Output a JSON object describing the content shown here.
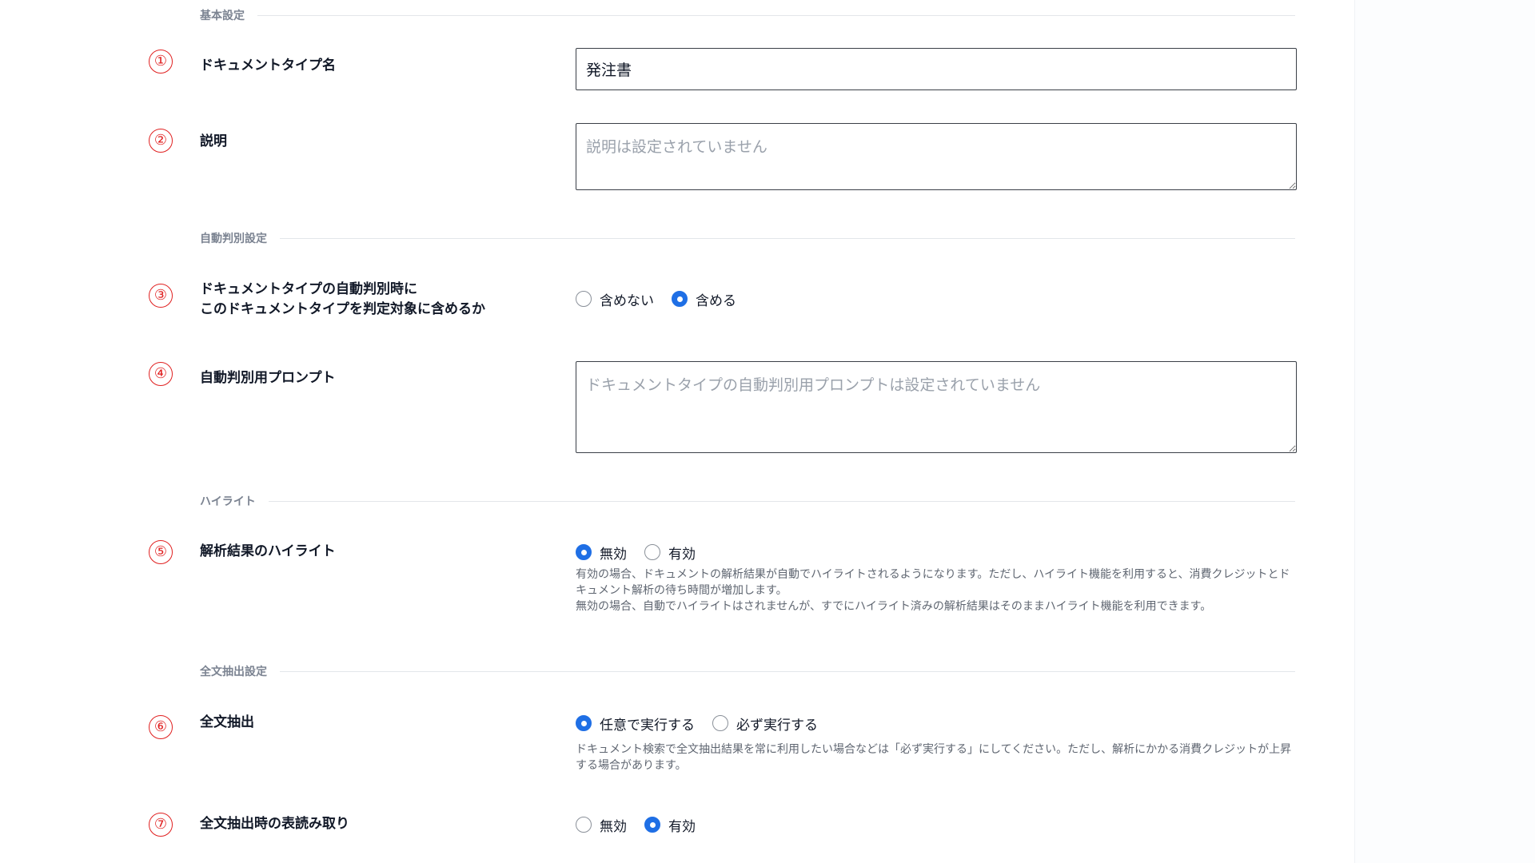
{
  "sections": {
    "basic": "基本設定",
    "auto": "自動判別設定",
    "highlight": "ハイライト",
    "fulltext": "全文抽出設定"
  },
  "markers": [
    "①",
    "②",
    "③",
    "④",
    "⑤",
    "⑥",
    "⑦"
  ],
  "fields": {
    "doc_type_name": {
      "label": "ドキュメントタイプ名",
      "value": "発注書"
    },
    "description": {
      "label": "説明",
      "placeholder": "説明は設定されていません"
    },
    "auto_include": {
      "label_line1": "ドキュメントタイプの自動判別時に",
      "label_line2": "このドキュメントタイプを判定対象に含めるか",
      "options": [
        "含めない",
        "含める"
      ],
      "selected": "含める"
    },
    "auto_prompt": {
      "label": "自動判別用プロンプト",
      "placeholder": "ドキュメントタイプの自動判別用プロンプトは設定されていません"
    },
    "highlight": {
      "label": "解析結果のハイライト",
      "options": [
        "無効",
        "有効"
      ],
      "selected": "無効",
      "help1": "有効の場合、ドキュメントの解析結果が自動でハイライトされるようになります。ただし、ハイライト機能を利用すると、消費クレジットとドキュメント解析の待ち時間が増加します。",
      "help2": "無効の場合、自動でハイライトはされませんが、すでにハイライト済みの解析結果はそのままハイライト機能を利用できます。"
    },
    "fulltext": {
      "label": "全文抽出",
      "options": [
        "任意で実行する",
        "必ず実行する"
      ],
      "selected": "任意で実行する",
      "help": "ドキュメント検索で全文抽出結果を常に利用したい場合などは「必ず実行する」にしてください。ただし、解析にかかる消費クレジットが上昇する場合があります。"
    },
    "fulltext_table": {
      "label": "全文抽出時の表読み取り",
      "options": [
        "無効",
        "有効"
      ],
      "selected": "有効"
    }
  },
  "colors": {
    "accent": "#1f6fe5",
    "marker": "#e02020",
    "section": "#7b8391"
  }
}
